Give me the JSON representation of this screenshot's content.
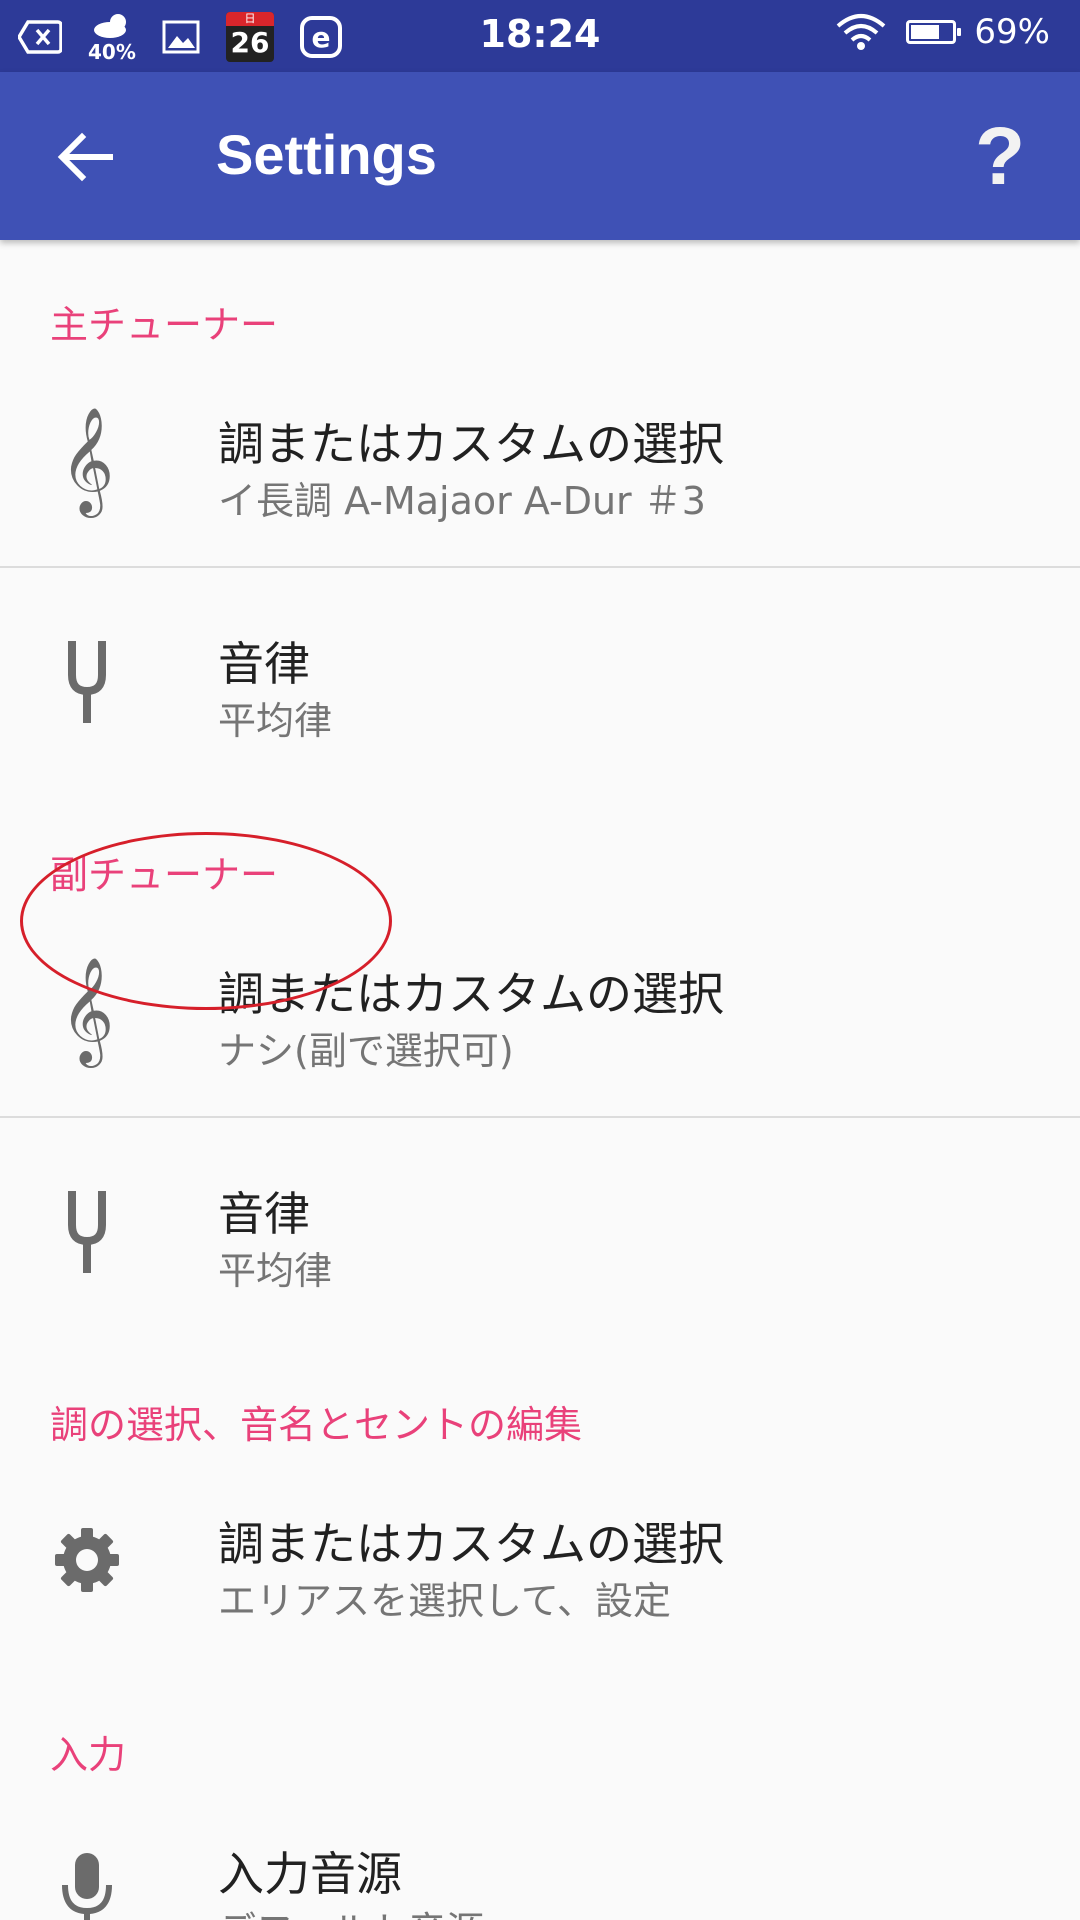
{
  "status_bar": {
    "weather_percent": "40%",
    "calendar_kanji": "日",
    "calendar_day": "26",
    "e_icon_letter": "e",
    "time": "18:24",
    "battery_percent_text": "69%",
    "battery_level": 0.69,
    "colors": {
      "background": "#2d3a98",
      "text": "#ffffff"
    },
    "icons": [
      "notification-x-icon",
      "weather-icon",
      "gallery-icon",
      "calendar-icon",
      "e-app-icon",
      "wifi-icon",
      "battery-icon"
    ]
  },
  "app_bar": {
    "title": "Settings",
    "help_label": "?",
    "colors": {
      "background": "#3f51b5",
      "text": "#ffffff"
    },
    "icons": [
      "back-arrow-icon",
      "help-icon"
    ]
  },
  "sections": [
    {
      "header": "主チューナー",
      "items": [
        {
          "icon": "treble-clef-icon",
          "title": "調またはカスタムの選択",
          "summary": "イ長調 A-Majaor A-Dur ＃3"
        },
        {
          "icon": "tuning-fork-icon",
          "title": "音律",
          "summary": "平均律"
        }
      ]
    },
    {
      "header": "副チューナー",
      "items": [
        {
          "icon": "treble-clef-icon",
          "title": "調またはカスタムの選択",
          "summary": "ナシ(副で選択可)"
        },
        {
          "icon": "tuning-fork-icon",
          "title": "音律",
          "summary": "平均律"
        }
      ]
    },
    {
      "header": "調の選択、音名とセントの編集",
      "items": [
        {
          "icon": "gear-icon",
          "title": "調またはカスタムの選択",
          "summary": "エリアスを選択して、設定"
        }
      ]
    },
    {
      "header": "入力",
      "items": [
        {
          "icon": "microphone-icon",
          "title": "入力音源",
          "summary": "デフォルト音源"
        }
      ]
    }
  ],
  "glyphs": {
    "treble_clef": "𝄞"
  },
  "colors": {
    "section_header": "#e9417a",
    "title": "#212121",
    "summary": "#757575",
    "icon": "#6b6b6b",
    "highlight": "#d61f2a"
  }
}
